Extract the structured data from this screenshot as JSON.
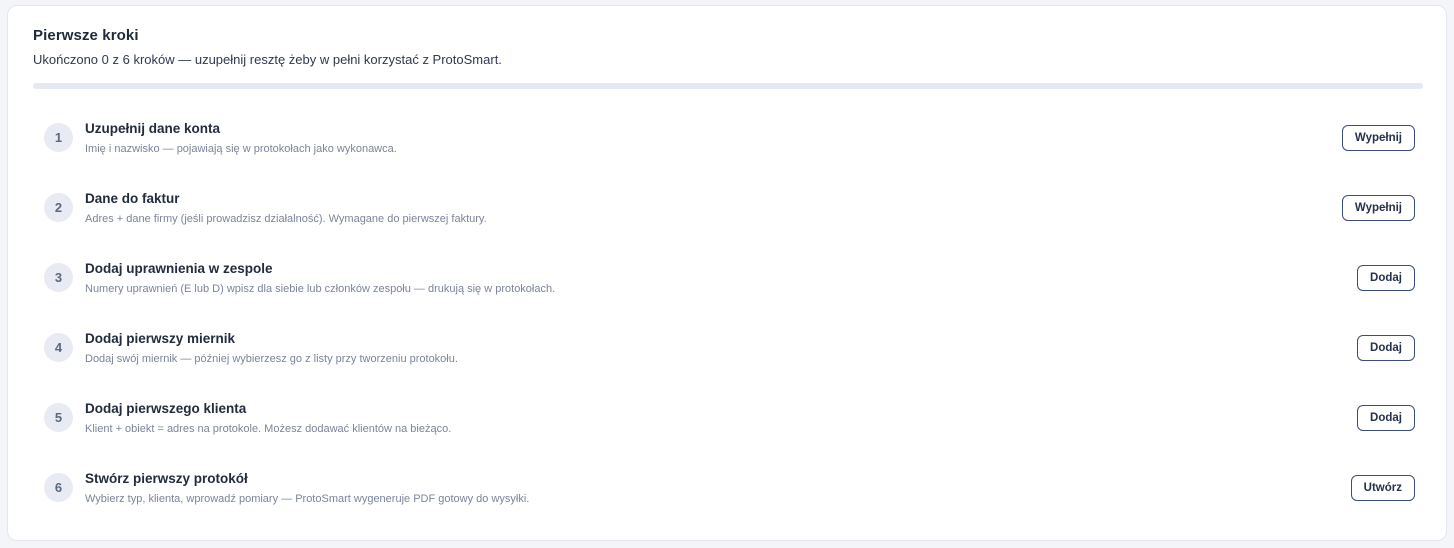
{
  "onboarding": {
    "title": "Pierwsze kroki",
    "subtitle": "Ukończono 0 z 6 kroków — uzupełnij resztę żeby w pełni korzystać z ProtoSmart.",
    "progress": {
      "completed": 0,
      "total": 6
    },
    "colors": {
      "accent": "#3b4e73",
      "track": "#e6e9f3"
    },
    "steps": [
      {
        "number": "1",
        "title": "Uzupełnij dane konta",
        "description": "Imię i nazwisko — pojawiają się w protokołach jako wykonawca.",
        "action": "Wypełnij"
      },
      {
        "number": "2",
        "title": "Dane do faktur",
        "description": "Adres + dane firmy (jeśli prowadzisz działalność). Wymagane do pierwszej faktury.",
        "action": "Wypełnij"
      },
      {
        "number": "3",
        "title": "Dodaj uprawnienia w zespole",
        "description": "Numery uprawnień (E lub D) wpisz dla siebie lub członków zespołu — drukują się w protokołach.",
        "action": "Dodaj"
      },
      {
        "number": "4",
        "title": "Dodaj pierwszy miernik",
        "description": "Dodaj swój miernik — później wybierzesz go z listy przy tworzeniu protokołu.",
        "action": "Dodaj"
      },
      {
        "number": "5",
        "title": "Dodaj pierwszego klienta",
        "description": "Klient + obiekt = adres na protokole. Możesz dodawać klientów na bieżąco.",
        "action": "Dodaj"
      },
      {
        "number": "6",
        "title": "Stwórz pierwszy protokół",
        "description": "Wybierz typ, klienta, wprowadź pomiary — ProtoSmart wygeneruje PDF gotowy do wysyłki.",
        "action": "Utwórz"
      }
    ]
  }
}
